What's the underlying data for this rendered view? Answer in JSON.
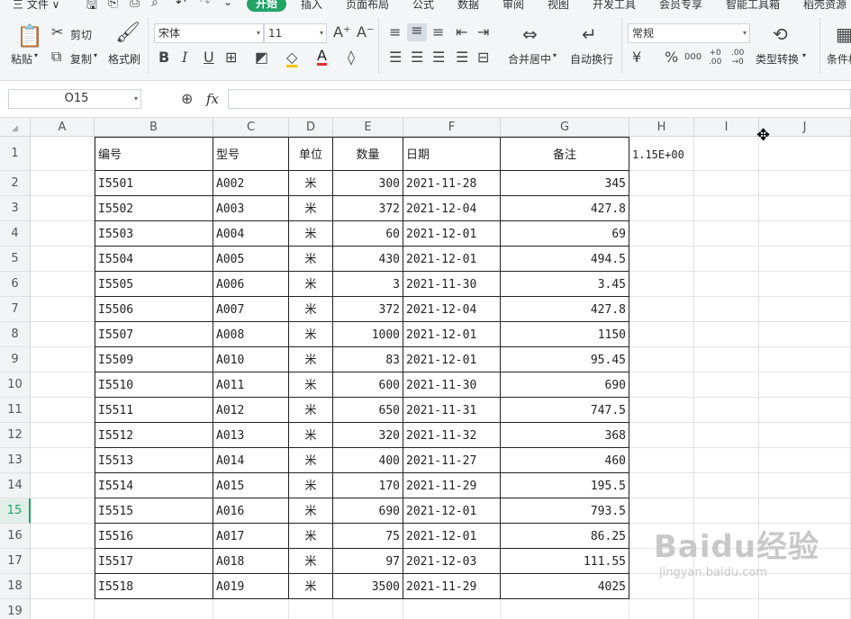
{
  "menu": {
    "items": [
      "三 文件 ∨",
      "开始",
      "插入",
      "页面布局",
      "公式",
      "数据",
      "审阅",
      "视图",
      "开发工具",
      "会员专享",
      "智能工具箱",
      "稻壳资源"
    ]
  },
  "ribbon": {
    "paste": "粘贴",
    "cut": "剪切",
    "copy": "复制",
    "format_painter": "格式刷",
    "font_name": "宋体",
    "font_size": "11",
    "merge_center": "合并居中",
    "auto_wrap": "自动换行",
    "number_format": "常规",
    "type_convert": "类型转换",
    "cond_format": "条件格"
  },
  "formula_bar": {
    "name_box": "O15",
    "fx": "fx",
    "formula": ""
  },
  "columns": [
    "A",
    "B",
    "C",
    "D",
    "E",
    "F",
    "G",
    "H",
    "I",
    "J"
  ],
  "rows": [
    "1",
    "2",
    "3",
    "4",
    "5",
    "6",
    "7",
    "8",
    "9",
    "10",
    "11",
    "12",
    "13",
    "14",
    "15",
    "16",
    "17",
    "18",
    "19"
  ],
  "selected_row": "15",
  "header_row": [
    "编号",
    "型号",
    "单位",
    "数量",
    "日期",
    "备注"
  ],
  "h1_value": "1.15E+00",
  "records": [
    [
      "I5501",
      "A002",
      "米",
      "300",
      "2021-11-28",
      "345"
    ],
    [
      "I5502",
      "A003",
      "米",
      "372",
      "2021-12-04",
      "427.8"
    ],
    [
      "I5503",
      "A004",
      "米",
      "60",
      "2021-12-01",
      "69"
    ],
    [
      "I5504",
      "A005",
      "米",
      "430",
      "2021-12-01",
      "494.5"
    ],
    [
      "I5505",
      "A006",
      "米",
      "3",
      "2021-11-30",
      "3.45"
    ],
    [
      "I5506",
      "A007",
      "米",
      "372",
      "2021-12-04",
      "427.8"
    ],
    [
      "I5507",
      "A008",
      "米",
      "1000",
      "2021-12-01",
      "1150"
    ],
    [
      "I5509",
      "A010",
      "米",
      "83",
      "2021-12-01",
      "95.45"
    ],
    [
      "I5510",
      "A011",
      "米",
      "600",
      "2021-11-30",
      "690"
    ],
    [
      "I5511",
      "A012",
      "米",
      "650",
      "2021-11-31",
      "747.5"
    ],
    [
      "I5512",
      "A013",
      "米",
      "320",
      "2021-11-32",
      "368"
    ],
    [
      "I5513",
      "A014",
      "米",
      "400",
      "2021-11-27",
      "460"
    ],
    [
      "I5514",
      "A015",
      "米",
      "170",
      "2021-11-29",
      "195.5"
    ],
    [
      "I5515",
      "A016",
      "米",
      "690",
      "2021-12-01",
      "793.5"
    ],
    [
      "I5516",
      "A017",
      "米",
      "75",
      "2021-12-01",
      "86.25"
    ],
    [
      "I5517",
      "A018",
      "米",
      "97",
      "2021-12-03",
      "111.55"
    ],
    [
      "I5518",
      "A019",
      "米",
      "3500",
      "2021-11-29",
      "4025"
    ]
  ],
  "watermark": {
    "brand": "Baidu经验",
    "url": "jingyan.baidu.com"
  },
  "colors": {
    "accent": "#21a366"
  }
}
